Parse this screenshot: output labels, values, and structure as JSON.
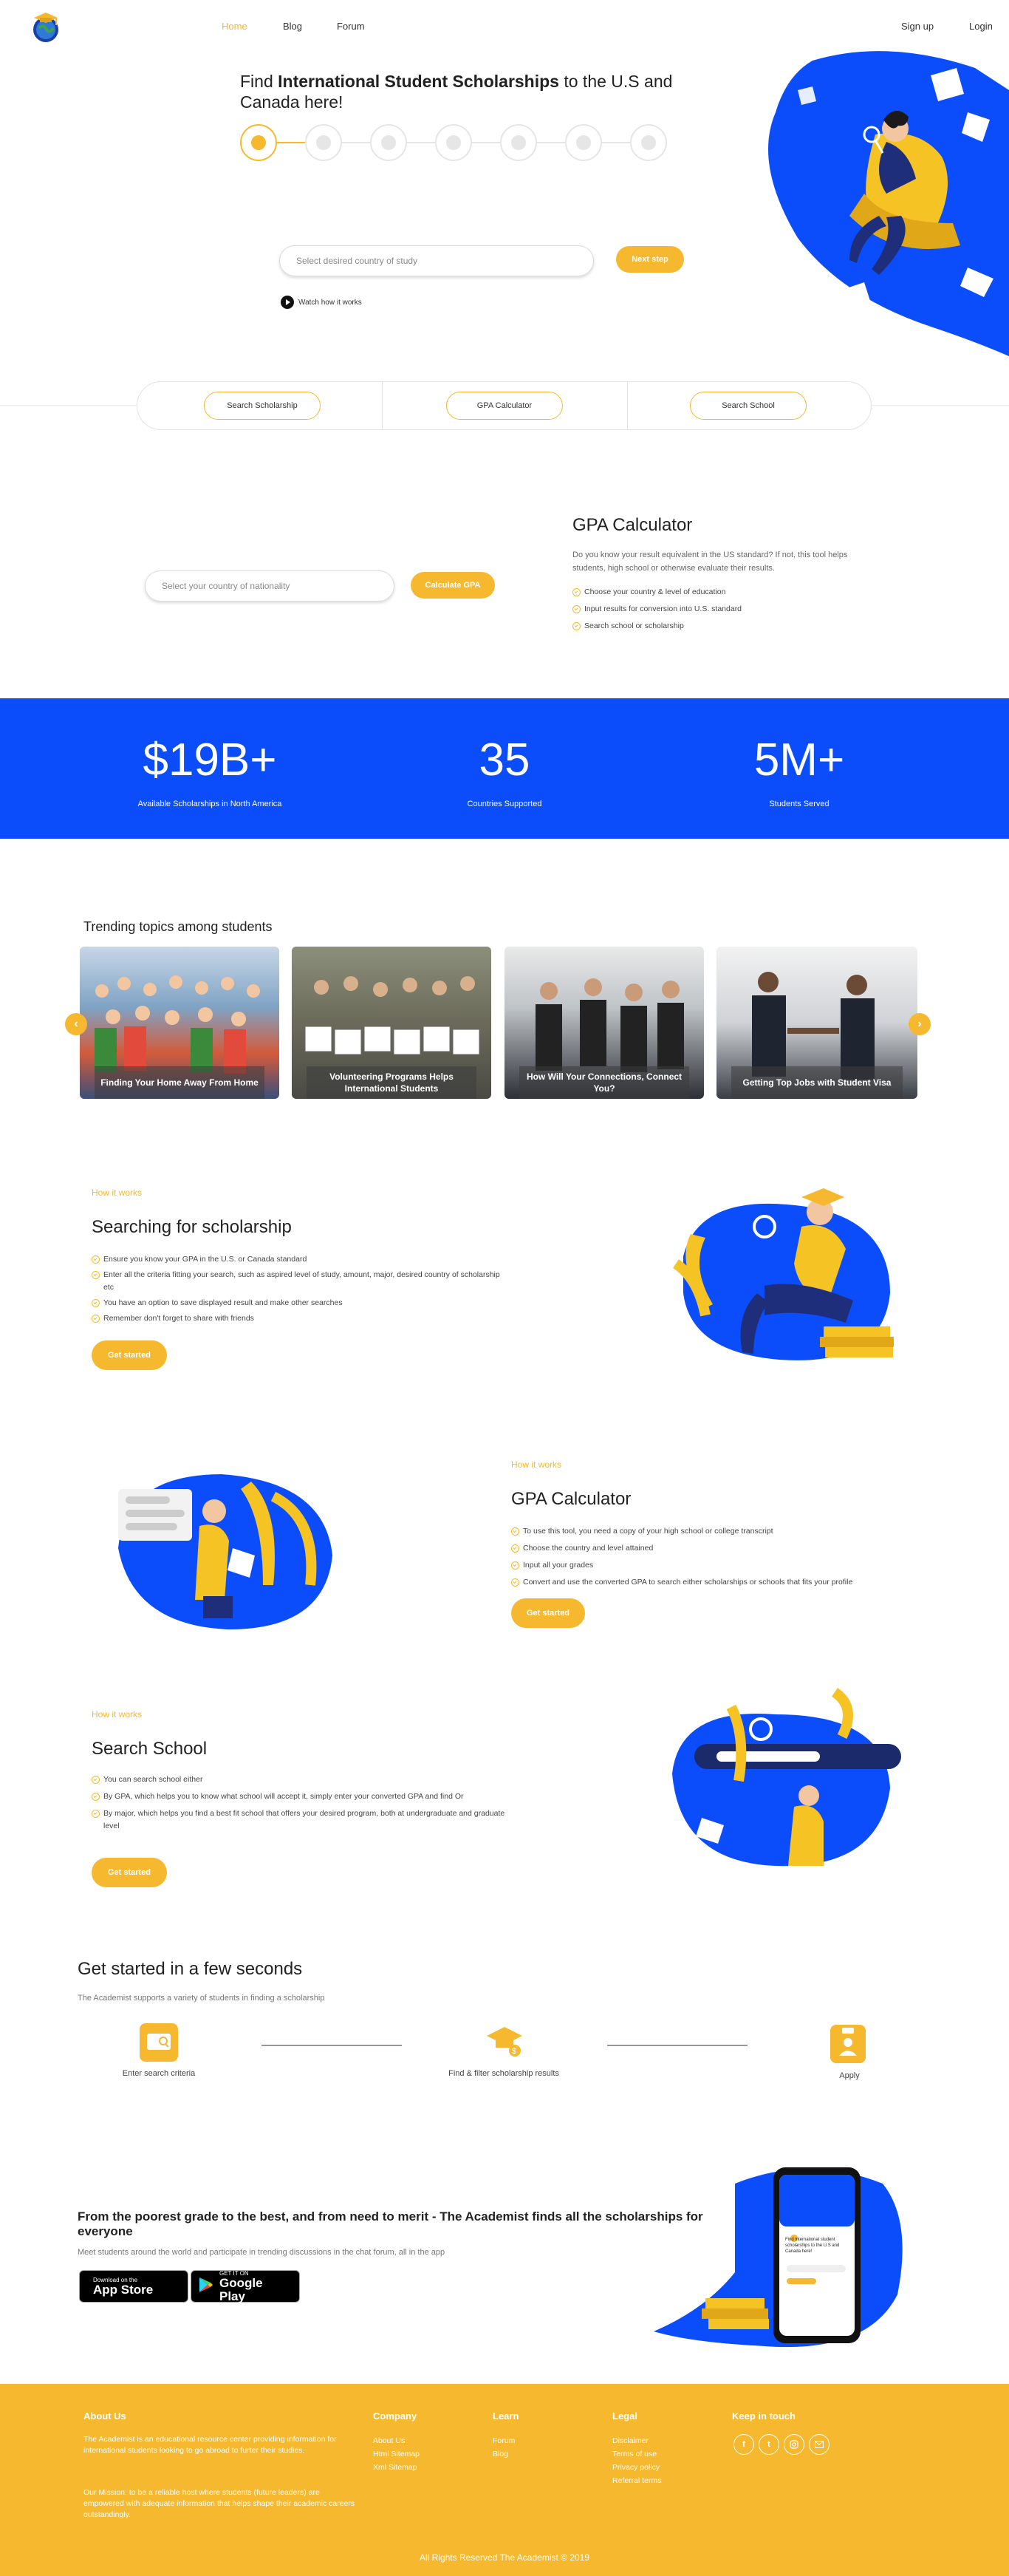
{
  "header": {
    "nav": [
      "Home",
      "Blog",
      "Forum"
    ],
    "signup": "Sign up",
    "login": "Login"
  },
  "hero": {
    "title_pre": "Find ",
    "title_bold": "International Student Scholarships",
    "title_post": " to the U.S and Canada here!",
    "country_placeholder": "Select desired country of study",
    "next_button": "Next step",
    "watch_link": "Watch how it works"
  },
  "tabs": [
    "Search Scholarship",
    "GPA Calculator",
    "Search School"
  ],
  "gpa_section": {
    "placeholder": "Select your country of nationality",
    "button": "Calculate GPA",
    "title": "GPA Calculator",
    "description": "Do you know your result equivalent in the US standard? If not, this tool helps students, high school or otherwise evaluate their results.",
    "bullets": [
      "Choose your country & level of education",
      "Input results for conversion into U.S. standard",
      "Search school or scholarship"
    ]
  },
  "stats": [
    {
      "value": "$19B+",
      "label": "Available Scholarships in North America"
    },
    {
      "value": "35",
      "label": "Countries Supported"
    },
    {
      "value": "5M+",
      "label": "Students Served"
    }
  ],
  "trending": {
    "title": "Trending topics among students",
    "cards": [
      "Finding Your Home Away From Home",
      "Volunteering Programs Helps International Students",
      "How Will Your Connections, Connect You?",
      "Getting Top Jobs with Student Visa"
    ]
  },
  "how_it_works": [
    {
      "label": "How it works",
      "title": "Searching for scholarship",
      "bullets": [
        "Ensure you know your GPA in the U.S. or Canada standard",
        "Enter all the criteria fitting your search, such as aspired level of study, amount, major, desired country of scholarship etc",
        "You have an option to save displayed result and make other searches",
        "Remember don't forget to share with friends"
      ],
      "button": "Get started"
    },
    {
      "label": "How it works",
      "title": "GPA Calculator",
      "bullets": [
        "To use this tool, you need a copy of your high school or college transcript",
        "Choose the country and level attained",
        "Input all your grades",
        "Convert and use the converted GPA to search either scholarships or schools that fits your profile"
      ],
      "button": "Get started"
    },
    {
      "label": "How it works",
      "title": "Search School",
      "bullets": [
        "You can search school either",
        "By GPA, which helps you to know what school will accept it, simply enter your converted GPA and find Or",
        "By major, which helps you find a best fit school that offers your desired program, both at undergraduate and graduate level"
      ],
      "button": "Get started"
    }
  ],
  "get_started": {
    "title": "Get started in a few seconds",
    "subtitle": "The Academist supports a variety of students in finding a scholarship",
    "steps": [
      "Enter search criteria",
      "Find & filter scholarship results",
      "Apply"
    ]
  },
  "app_promo": {
    "title": "From the poorest grade to the best, and from need to merit - The Academist finds all the scholarships for everyone",
    "subtitle": "Meet students around the world and participate in trending discussions in the chat forum, all in the app",
    "app_store_small": "Download on the",
    "app_store_big": "App Store",
    "google_small": "GET IT ON",
    "google_big": "Google Play",
    "phone_text": "Find international student scholarships to the U.S and Canada here!"
  },
  "footer": {
    "about_title": "About Us",
    "about_text": "The Academist is an educational resource center providing information for international students looking to go abroad to furter their studies.",
    "mission_text": "Our Mission: to be a reliable host where students (future leaders) are empowered with adequate information that helps shape their academic careers outstandingly.",
    "company_title": "Company",
    "company_links": [
      "About Us",
      "Html Sitemap",
      "Xml Sitemap"
    ],
    "learn_title": "Learn",
    "learn_links": [
      "Forum",
      "Blog"
    ],
    "legal_title": "Legal",
    "legal_links": [
      "Disclaimer",
      "Terms of use",
      "Privacy policy",
      "Referral terms"
    ],
    "touch_title": "Keep in touch",
    "copyright": "All Rights Reserved The Academist © 2019"
  },
  "colors": {
    "brand_yellow": "#f5b82e",
    "brand_blue": "#0b4dfa"
  }
}
